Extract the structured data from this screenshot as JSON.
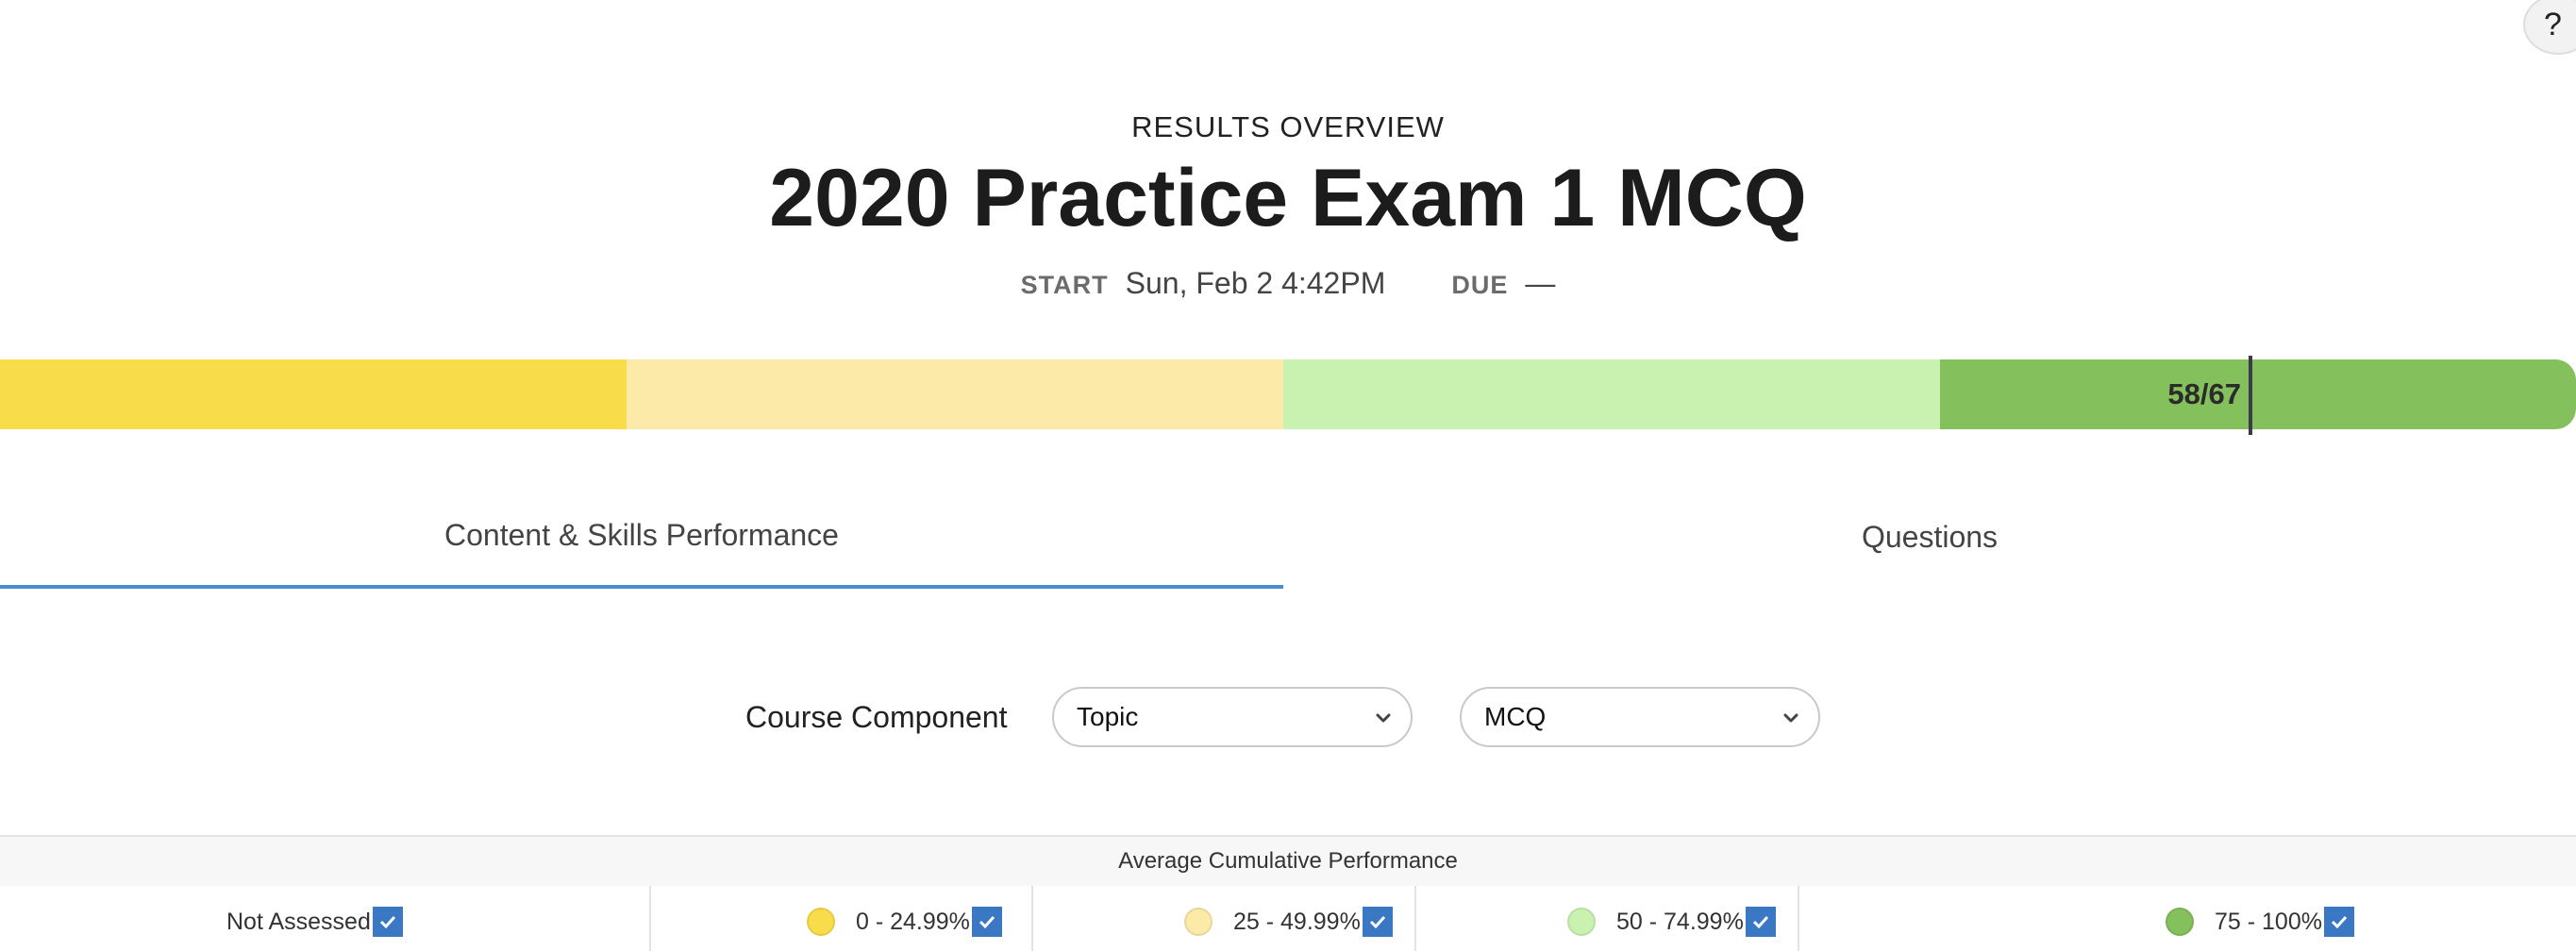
{
  "help": {
    "label": "?"
  },
  "header": {
    "overline": "RESULTS OVERVIEW",
    "title": "2020 Practice Exam 1 MCQ",
    "start_label": "START",
    "start_value": "Sun, Feb 2 4:42PM",
    "due_label": "DUE",
    "due_value": "—"
  },
  "score_bar": {
    "score_text": "58/67",
    "score_fraction": 0.866,
    "band_colors": [
      "#f9dc4a",
      "#fbeaa8",
      "#c9f2b0",
      "#84c05b"
    ]
  },
  "tabs": [
    {
      "label": "Content & Skills Performance",
      "active": true
    },
    {
      "label": "Questions",
      "active": false
    }
  ],
  "filters": {
    "label": "Course Component",
    "select1": "Topic",
    "select2": "MCQ"
  },
  "performance": {
    "header": "Average Cumulative Performance",
    "legend": [
      {
        "label": "Not Assessed",
        "color": ""
      },
      {
        "label": "0 - 24.99%",
        "color": "#f9dc4a"
      },
      {
        "label": "25 - 49.99%",
        "color": "#fbeaa8"
      },
      {
        "label": "50 - 74.99%",
        "color": "#c9f2b0"
      },
      {
        "label": "75 - 100%",
        "color": "#84c05b"
      }
    ]
  },
  "colors": {
    "accent": "#4a8ccc",
    "checkbox": "#3b78c4"
  }
}
